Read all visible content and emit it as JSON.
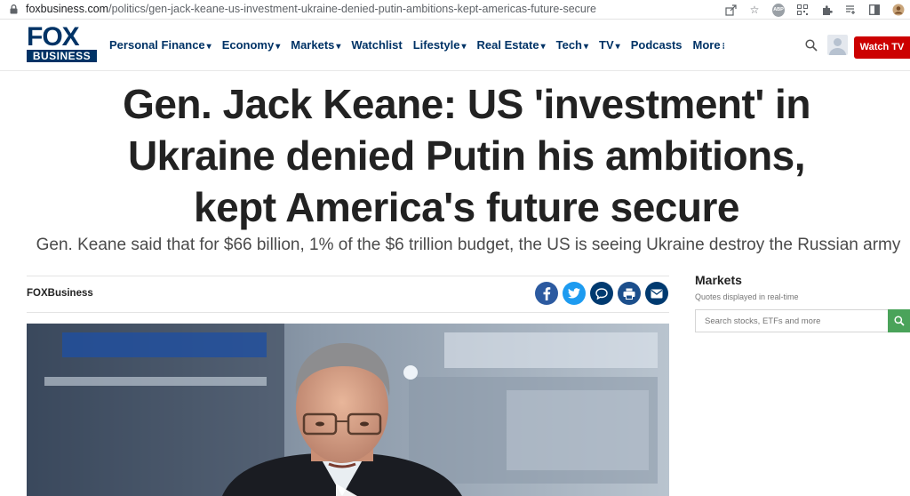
{
  "browser": {
    "url_host": "foxbusiness.com",
    "url_path": "/politics/gen-jack-keane-us-investment-ukraine-denied-putin-ambitions-kept-americas-future-secure",
    "extension_abp": "ABP"
  },
  "header": {
    "logo_top": "FOX",
    "logo_bottom": "BUSINESS",
    "nav": [
      {
        "label": "Personal Finance",
        "caret": "▾"
      },
      {
        "label": "Economy",
        "caret": "▾"
      },
      {
        "label": "Markets",
        "caret": "▾"
      },
      {
        "label": "Watchlist",
        "caret": ""
      },
      {
        "label": "Lifestyle",
        "caret": "▾"
      },
      {
        "label": "Real Estate",
        "caret": "▾"
      },
      {
        "label": "Tech",
        "caret": "▾"
      },
      {
        "label": "TV",
        "caret": "▾"
      },
      {
        "label": "Podcasts",
        "caret": ""
      },
      {
        "label": "More",
        "caret": "⁝"
      }
    ],
    "watch_tv": "Watch TV"
  },
  "article": {
    "headline_line1": "Gen. Jack Keane: US 'investment' in",
    "headline_line2": "Ukraine denied Putin his ambitions,",
    "headline_line3": "kept America's future secure",
    "subhead": "Gen. Keane said that for $66 billion, 1% of the $6 trillion budget, the US is seeing Ukraine destroy the Russian army",
    "byline": "FOXBusiness"
  },
  "markets": {
    "title": "Markets",
    "subtitle": "Quotes displayed in real-time",
    "search_placeholder": "Search stocks, ETFs and more"
  },
  "colors": {
    "brand_navy": "#003366",
    "watch_tv_red": "#cc0000",
    "search_green": "#4aa35a"
  }
}
